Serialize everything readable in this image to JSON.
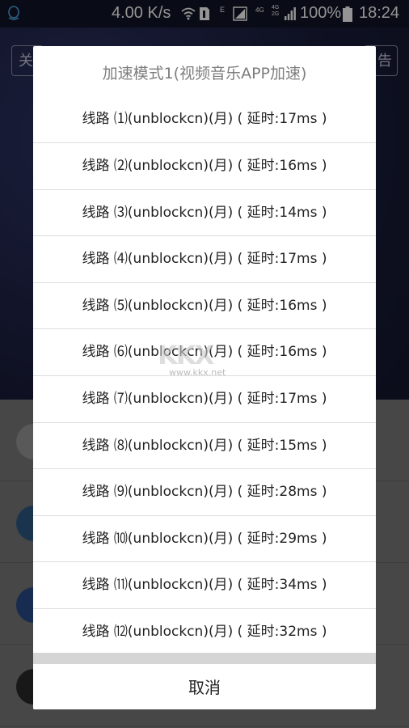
{
  "status_bar": {
    "speed": "4.00 K/s",
    "e_label": "E",
    "net_4g": "4G",
    "net_4g2g": "4G\n2G",
    "battery": "100%",
    "time": "18:24"
  },
  "background": {
    "left_button_label": "关",
    "right_button_label": "告"
  },
  "dialog": {
    "title": "加速模式1(视频音乐APP加速)",
    "routes": [
      {
        "label": "线路 ⑴(unblockcn)(月) ( 延时:17ms )"
      },
      {
        "label": "线路 ⑵(unblockcn)(月) ( 延时:16ms )"
      },
      {
        "label": "线路 ⑶(unblockcn)(月) ( 延时:14ms )"
      },
      {
        "label": "线路 ⑷(unblockcn)(月) ( 延时:17ms )"
      },
      {
        "label": "线路 ⑸(unblockcn)(月) ( 延时:16ms )"
      },
      {
        "label": "线路 ⑹(unblockcn)(月) ( 延时:16ms )"
      },
      {
        "label": "线路 ⑺(unblockcn)(月) ( 延时:17ms )"
      },
      {
        "label": "线路 ⑻(unblockcn)(月) ( 延时:15ms )"
      },
      {
        "label": "线路 ⑼(unblockcn)(月) ( 延时:28ms )"
      },
      {
        "label": "线路 ⑽(unblockcn)(月) ( 延时:29ms )"
      },
      {
        "label": "线路 ⑾(unblockcn)(月) ( 延时:34ms )"
      },
      {
        "label": "线路 ⑿(unblockcn)(月) ( 延时:32ms )"
      }
    ],
    "cancel_label": "取消"
  },
  "watermark": {
    "logo": "KKX",
    "url": "www.kkx.net"
  },
  "colors": {
    "dialog_bg": "#ffffff",
    "title_text": "#7d7d7d",
    "item_text": "#222222",
    "divider": "#dedede"
  },
  "icons": [
    "qq-icon",
    "wifi-icon",
    "sim-icon",
    "signal-icon",
    "battery-icon"
  ]
}
